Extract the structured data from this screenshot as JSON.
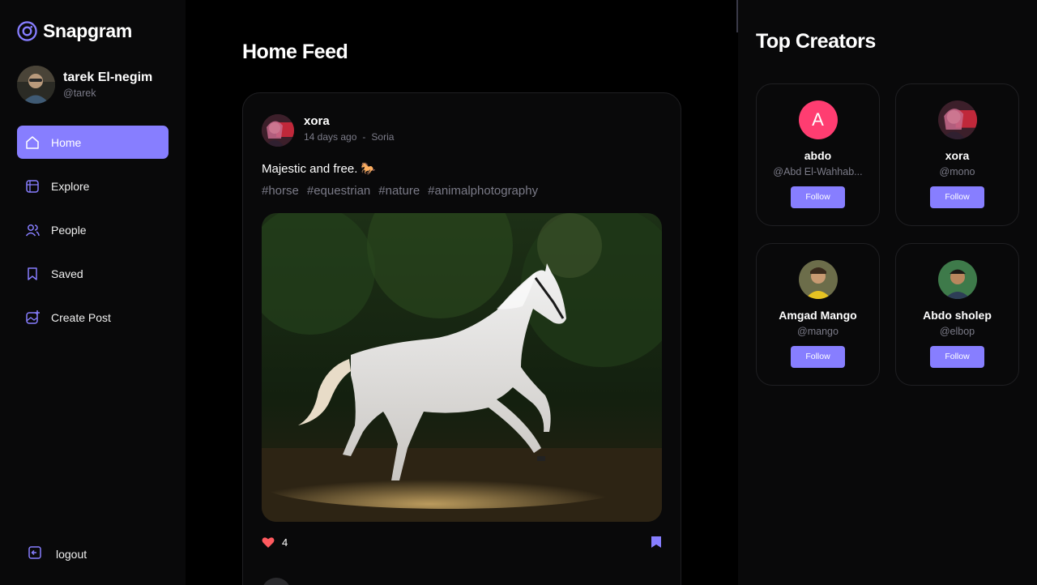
{
  "app": {
    "name": "Snapgram"
  },
  "user": {
    "name": "tarek El-negim",
    "handle": "@tarek"
  },
  "nav": {
    "items": [
      {
        "label": "Home",
        "icon": "home-icon",
        "active": true
      },
      {
        "label": "Explore",
        "icon": "explore-icon",
        "active": false
      },
      {
        "label": "People",
        "icon": "people-icon",
        "active": false
      },
      {
        "label": "Saved",
        "icon": "bookmark-icon",
        "active": false
      },
      {
        "label": "Create Post",
        "icon": "create-post-icon",
        "active": false
      }
    ],
    "logout_label": "logout"
  },
  "feed": {
    "title": "Home Feed",
    "post": {
      "author": "xora",
      "time": "14 days ago",
      "separator": "-",
      "location": "Soria",
      "caption": "Majestic and free.",
      "caption_emoji": "🐎",
      "tags": [
        "#horse",
        "#equestrian",
        "#nature",
        "#animalphotography"
      ],
      "likes": "4"
    }
  },
  "creators": {
    "title": "Top Creators",
    "follow_label": "Follow",
    "items": [
      {
        "name": "abdo",
        "handle": "@Abd El-Wahhab...",
        "avatar_letter": "A"
      },
      {
        "name": "xora",
        "handle": "@mono"
      },
      {
        "name": "Amgad Mango",
        "handle": "@mango"
      },
      {
        "name": "Abdo sholep",
        "handle": "@elbop"
      }
    ]
  },
  "colors": {
    "accent": "#877eff",
    "like": "#ff5a5f",
    "letter_avatar": "#ff3d71"
  }
}
